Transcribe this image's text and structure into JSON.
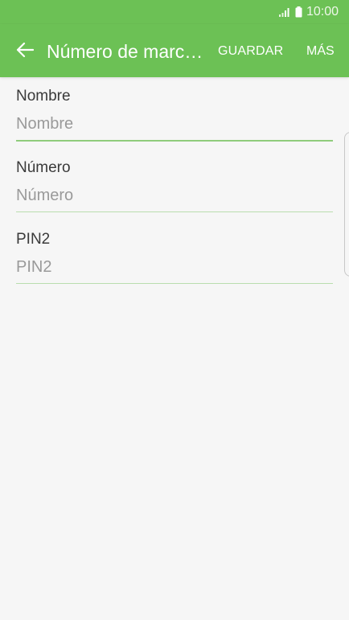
{
  "status_bar": {
    "time": "10:00",
    "signal_icon": "signal-icon",
    "battery_icon": "battery-icon"
  },
  "app_bar": {
    "back_icon": "arrow-left-icon",
    "title": "Número de marc…",
    "save_label": "GUARDAR",
    "more_label": "MÁS",
    "color": "#6cc155"
  },
  "form": {
    "fields": [
      {
        "label": "Nombre",
        "placeholder": "Nombre",
        "value": ""
      },
      {
        "label": "Número",
        "placeholder": "Número",
        "value": ""
      },
      {
        "label": "PIN2",
        "placeholder": "PIN2",
        "value": ""
      }
    ]
  }
}
